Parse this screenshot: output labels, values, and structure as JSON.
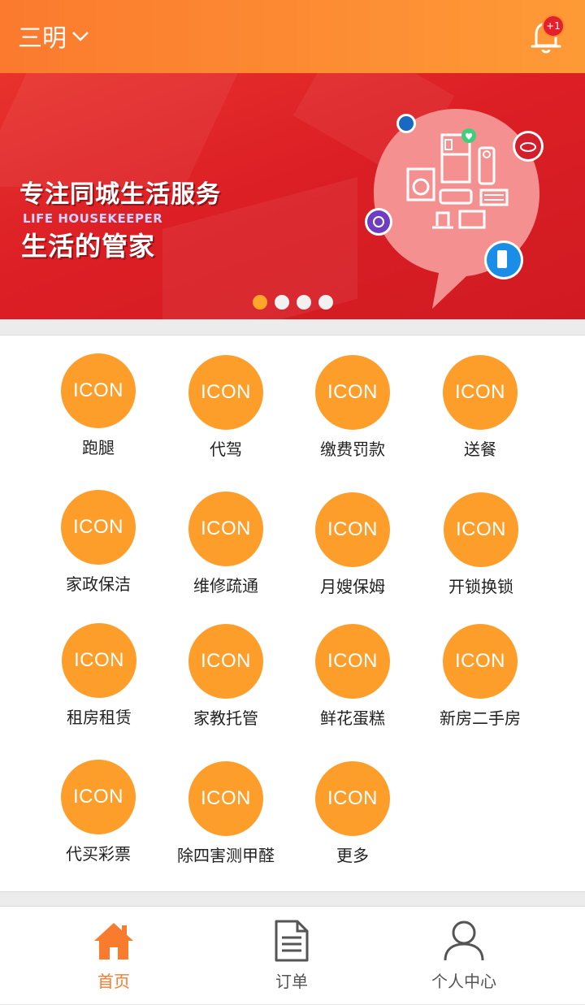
{
  "header": {
    "city": "三明",
    "notification_badge": "+1"
  },
  "banner": {
    "title": "专注同城生活服务",
    "subtitle_en": "LIFE HOUSEKEEPER",
    "tagline": "生活的管家",
    "slide_count": 4,
    "active_slide": 0
  },
  "services": {
    "icon_placeholder": "ICON",
    "items": [
      {
        "label": "跑腿"
      },
      {
        "label": "代驾"
      },
      {
        "label": "缴费罚款"
      },
      {
        "label": "送餐"
      },
      {
        "label": "家政保洁"
      },
      {
        "label": "维修疏通"
      },
      {
        "label": "月嫂保姆"
      },
      {
        "label": "开锁换锁"
      },
      {
        "label": "租房租赁"
      },
      {
        "label": "家教托管"
      },
      {
        "label": "鲜花蛋糕"
      },
      {
        "label": "新房二手房"
      },
      {
        "label": "代买彩票"
      },
      {
        "label": "除四害测甲醛"
      },
      {
        "label": "更多"
      }
    ]
  },
  "nav": {
    "home": "首页",
    "orders": "订单",
    "profile": "个人中心"
  },
  "colors": {
    "header_orange": "#fd8c33",
    "icon_orange": "#fd9e2b",
    "banner_red": "#dc1f25",
    "nav_active": "#f97b2e",
    "badge_red": "#e6202a"
  }
}
